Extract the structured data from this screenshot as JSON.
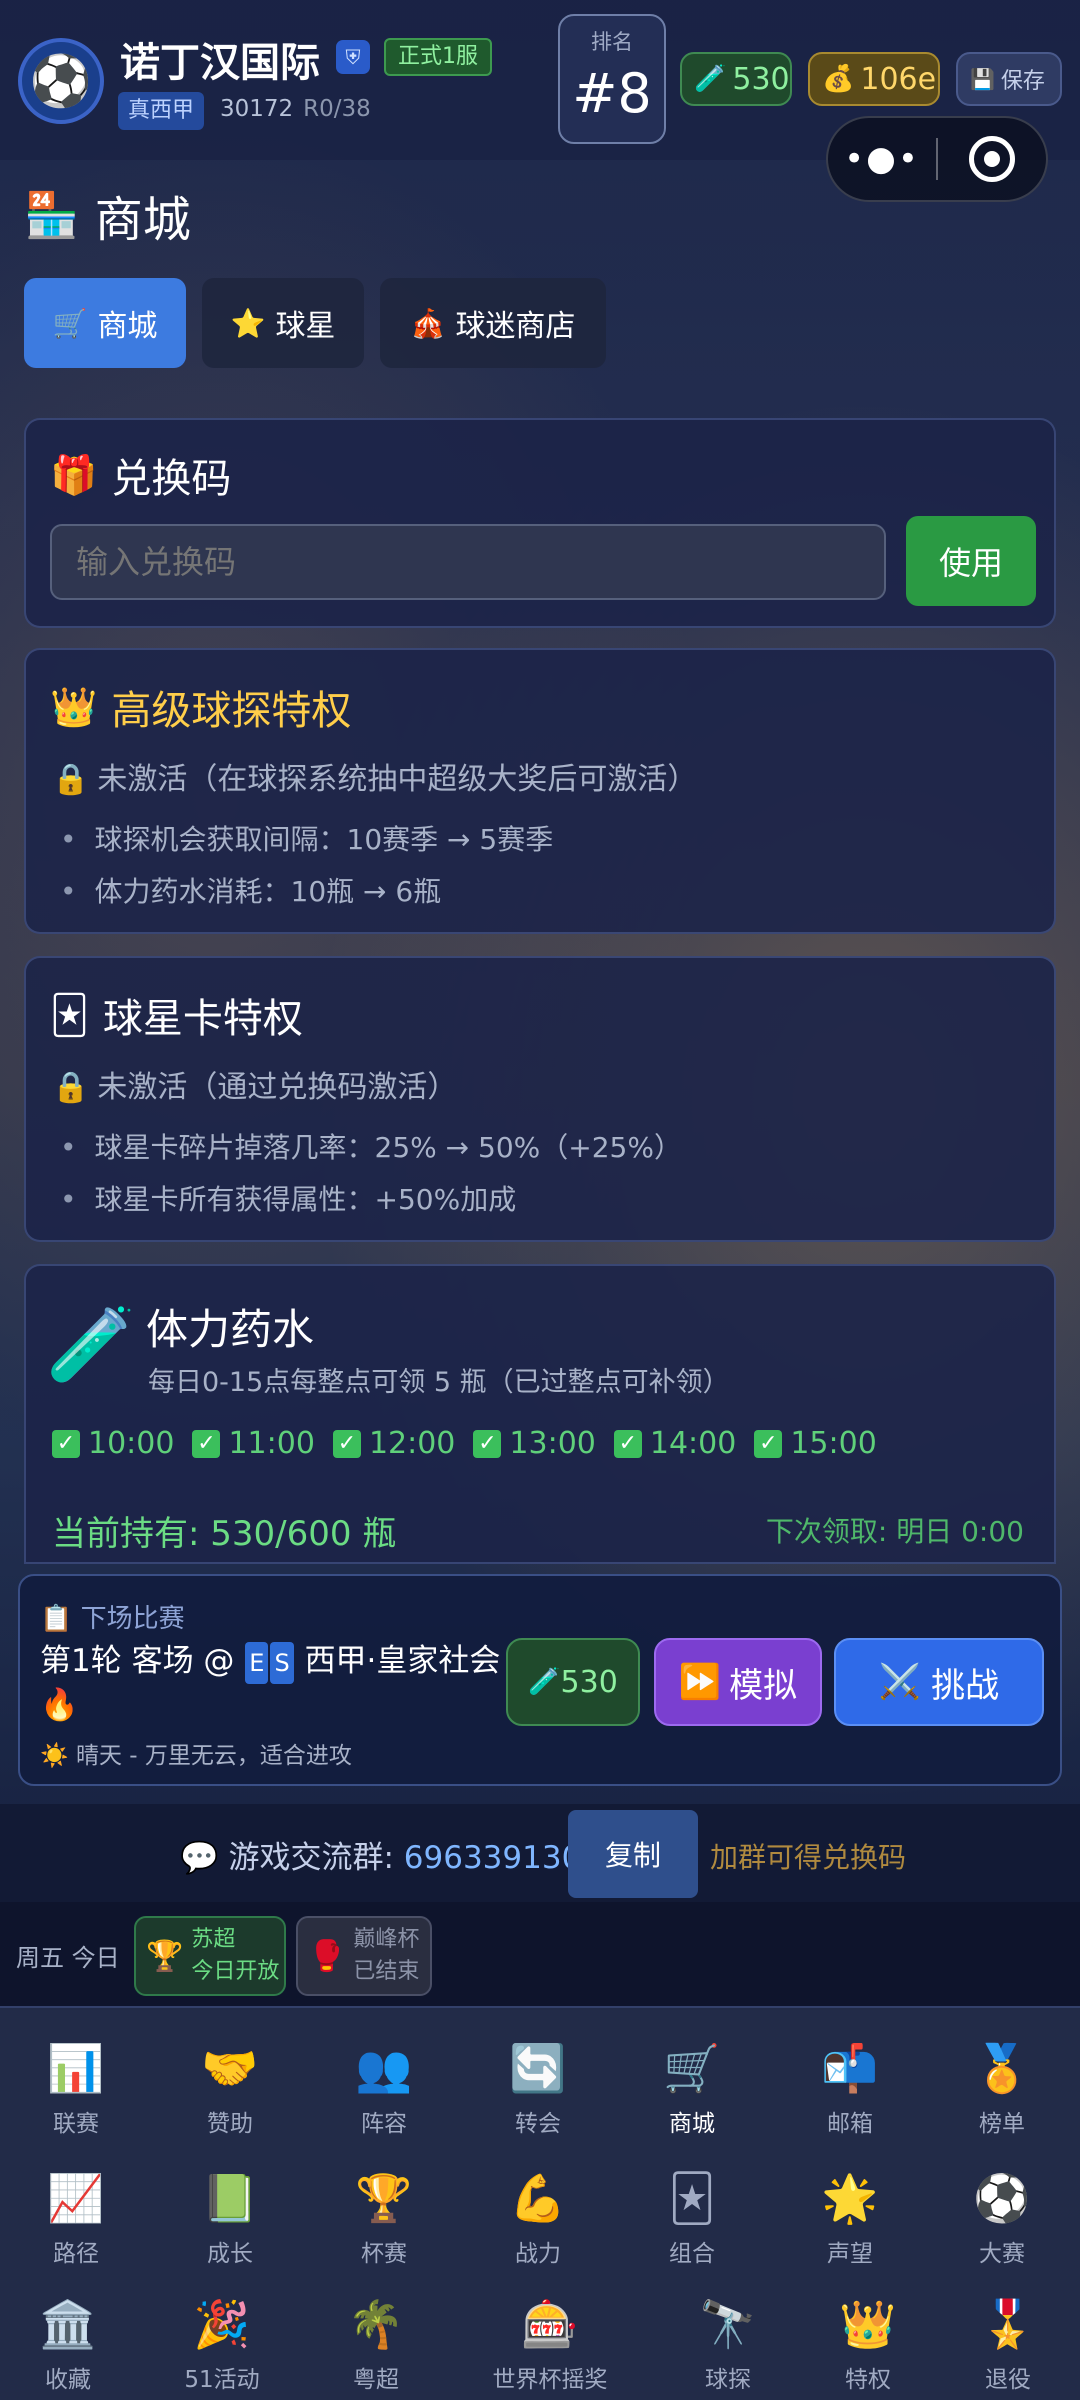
{
  "header": {
    "club_name": "诺丁汉国际",
    "server_badge": "正式1服",
    "league_badge": "真西甲",
    "club_id": "30172",
    "round": "R0/38",
    "rank_label": "排名",
    "rank_value": "#8",
    "potion_count": "530",
    "gold_amount": "106e",
    "save_label": "保存"
  },
  "page": {
    "title": "商城",
    "tabs": [
      {
        "label": "商城",
        "icon": "cart-icon"
      },
      {
        "label": "球星",
        "icon": "star-icon"
      },
      {
        "label": "球迷商店",
        "icon": "circus-tent-icon"
      }
    ]
  },
  "redeem": {
    "title": "兑换码",
    "placeholder": "输入兑换码",
    "button": "使用"
  },
  "scout_privilege": {
    "title": "高级球探特权",
    "status": "未激活（在球探系统抽中超级大奖后可激活）",
    "perks": [
      "球探机会获取间隔：10赛季 → 5赛季",
      "体力药水消耗：10瓶 → 6瓶"
    ]
  },
  "card_privilege": {
    "title": "球星卡特权",
    "status": "未激活（通过兑换码激活）",
    "perks": [
      "球星卡碎片掉落几率：25% → 50%（+25%）",
      "球星卡所有获得属性：+50%加成"
    ]
  },
  "potion": {
    "title": "体力药水",
    "desc": "每日0-15点每整点可领 5 瓶（已过整点可补领）",
    "slots": [
      "10:00",
      "11:00",
      "12:00",
      "13:00",
      "14:00",
      "15:00"
    ],
    "holding": "当前持有: 530/600 瓶",
    "next_claim": "下次领取: 明日 0:00"
  },
  "next_match": {
    "header": "下场比赛",
    "line_prefix": "第1轮 客场 @",
    "badge_letters": [
      "E",
      "S"
    ],
    "line_suffix": "西甲·皇家社会",
    "weather": "晴天 - 万里无云，适合进攻",
    "potion_cost": "530",
    "simulate": "模拟",
    "challenge": "挑战"
  },
  "group": {
    "label": "游戏交流群:",
    "number": "696339130",
    "copy": "复制",
    "note": "加群可得兑换码"
  },
  "cups": {
    "day": "周五 今日",
    "items": [
      {
        "name": "苏超",
        "status": "今日开放"
      },
      {
        "name": "巅峰杯",
        "status": "已结束"
      }
    ]
  },
  "nav": {
    "row1": [
      "联赛",
      "赞助",
      "阵容",
      "转会",
      "商城",
      "邮箱",
      "榜单"
    ],
    "row2": [
      "路径",
      "成长",
      "杯赛",
      "战力",
      "组合",
      "声望",
      "大赛"
    ],
    "row3": [
      "收藏",
      "51活动",
      "粤超",
      "世界杯摇奖",
      "球探",
      "特权",
      "退役"
    ]
  },
  "colors": {
    "accent_blue": "#3d7be0",
    "use_green": "#2a9a43",
    "simulate_purple": "#7a3fd0",
    "challenge_blue": "#2f6ae8",
    "gold_title": "#ffce4a"
  }
}
